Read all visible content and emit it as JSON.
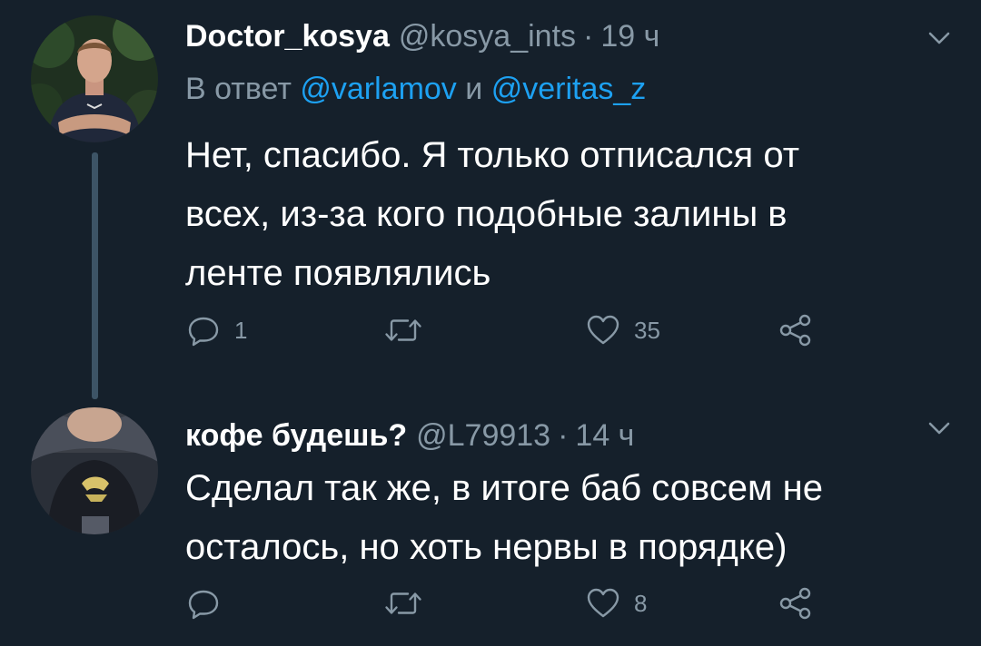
{
  "tweets": [
    {
      "display_name": "Doctor_kosya",
      "handle": "@kosya_ints",
      "separator": "·",
      "time": "19 ч",
      "reply_prefix": "В ответ",
      "reply_mention_1": "@varlamov",
      "reply_conjunction": "и",
      "reply_mention_2": "@veritas_z",
      "text_lines": [
        "Нет, спасибо. Я только отписался от",
        "всех, из-за кого подобные залины в",
        "ленте появлялись"
      ],
      "reply_count": "1",
      "retweet_count": "",
      "like_count": "35"
    },
    {
      "display_name": "кофе будешь?",
      "handle": "@L79913",
      "separator": "·",
      "time": "14 ч",
      "text_lines": [
        "Сделал так же, в итоге баб совсем не",
        "осталось, но хоть нервы в порядке)"
      ],
      "reply_count": "",
      "retweet_count": "",
      "like_count": "8"
    }
  ],
  "colors": {
    "background": "#15202b",
    "text_primary": "#ffffff",
    "text_secondary": "#8899a6",
    "link": "#1da1f2",
    "thread_line": "#3d5466"
  },
  "icons": {
    "reply": "reply-icon",
    "retweet": "retweet-icon",
    "like": "heart-icon",
    "share": "share-icon",
    "menu": "chevron-down-icon"
  }
}
